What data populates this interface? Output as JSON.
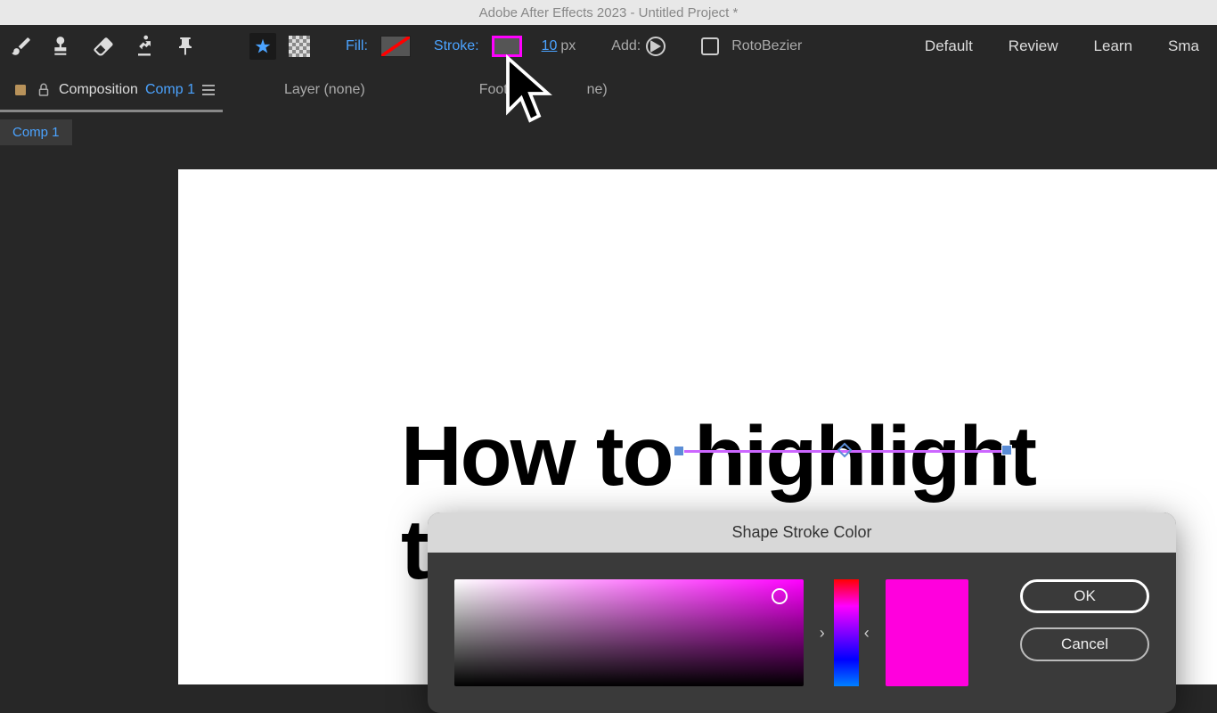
{
  "titlebar": "Adobe After Effects 2023 - Untitled Project *",
  "toolbar": {
    "fill_label": "Fill:",
    "stroke_label": "Stroke:",
    "stroke_width": "10",
    "stroke_unit": "px",
    "add_label": "Add:",
    "roto_label": "RotoBezier"
  },
  "workspace": {
    "default": "Default",
    "review": "Review",
    "learn": "Learn",
    "small": "Sma"
  },
  "tabs": {
    "composition_label": "Composition",
    "composition_name": "Comp 1",
    "layer": "Layer (none)",
    "footage_partial": "Foota",
    "footage_rest": "ne)"
  },
  "chip": "Comp 1",
  "canvas": {
    "line1": "How to highlight",
    "line2": "t"
  },
  "dialog": {
    "title": "Shape Stroke Color",
    "ok": "OK",
    "cancel": "Cancel",
    "selected_color": "#ff00dd"
  },
  "hue_nav": {
    "left": "›",
    "right": "‹"
  }
}
